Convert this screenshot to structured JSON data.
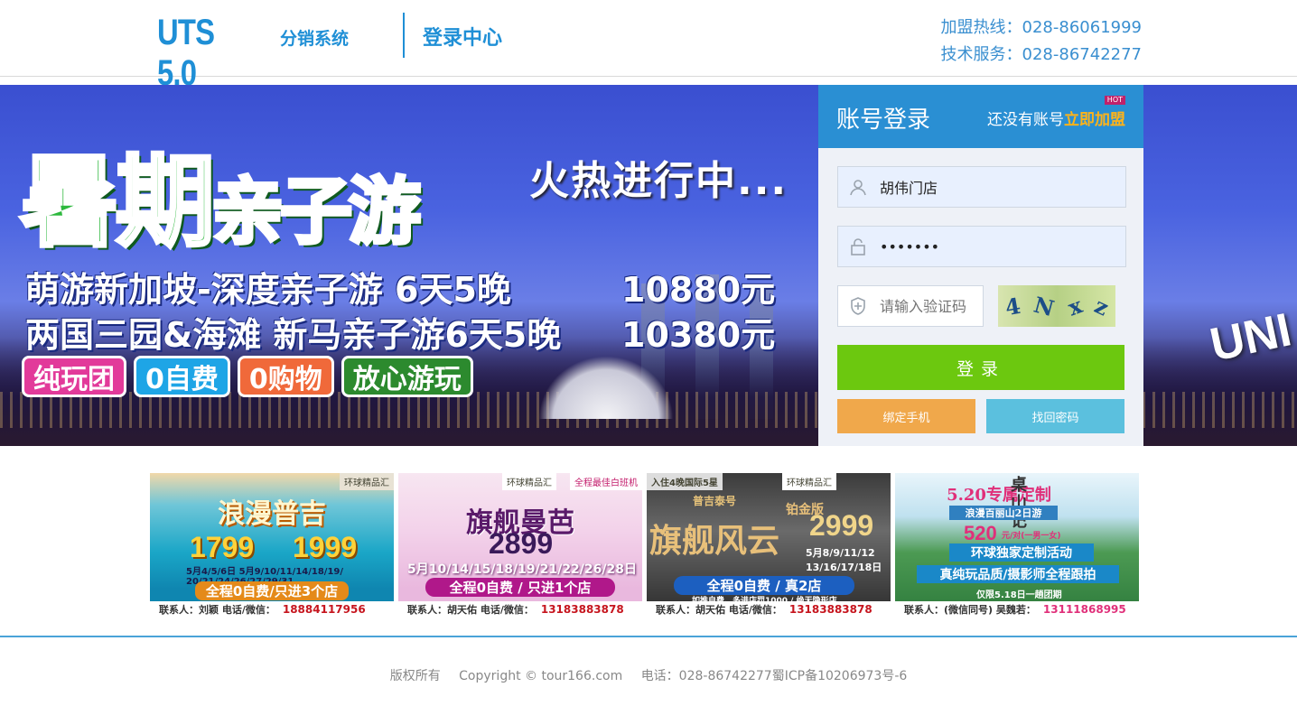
{
  "header": {
    "logo_main": "UTS 5.0",
    "logo_sub": "分销系统",
    "title": "登录中心",
    "hotline_join": "加盟热线：028-86061999",
    "hotline_tech": "技术服务：028-86742277"
  },
  "banner": {
    "headline": "暑期",
    "headline_small": "亲子游",
    "slogan": "火热进行中...",
    "lines": [
      {
        "text": "萌游新加坡-深度亲子游 6天5晚",
        "price": "10880元"
      },
      {
        "text": "两国三园&海滩 新马亲子游6天5晚",
        "price": "10380元"
      }
    ],
    "badges": [
      "纯玩团",
      "0自费",
      "0购物",
      "放心游玩"
    ],
    "badge_colors": [
      "#e23a9a",
      "#1ea5e6",
      "#f0693a",
      "#2c8a2e"
    ],
    "uni_text": "UNI"
  },
  "login": {
    "title": "账号登录",
    "join_prefix": "还没有账号",
    "join_link": "立即加盟",
    "hot": "HOT",
    "username_value": "胡伟门店",
    "password_value": "•••••••",
    "captcha_placeholder": "请输入验证码",
    "captcha_chars": [
      "4",
      "N",
      "x",
      "z"
    ],
    "submit": "登录",
    "bind_phone": "绑定手机",
    "recover": "找回密码",
    "icons": {
      "user": "user-icon",
      "lock": "lock-icon",
      "shield": "shield-icon"
    }
  },
  "promos": [
    {
      "tag": "环球精品汇",
      "title": "浪漫普吉",
      "price_a": "1799",
      "price_b": "1999",
      "dates": "5月4/5/6日 5月9/10/11/14/18/19/ 20/21/24/26/27/29/31",
      "strip": "全程0自费/只进3个店",
      "contact_label": "联系人：刘颖  电话/微信：",
      "contact_number": "18884117956"
    },
    {
      "tag": "环球精品汇",
      "tag2": "全程最佳白班机",
      "title": "旗舰曼芭",
      "price_a": "2899",
      "dates": "5月10/14/15/18/19/21/22/26/28日",
      "strip": "全程0自费 / 只进1个店",
      "contact_label": "联系人：胡天佑  电话/微信：",
      "contact_number": "13183883878"
    },
    {
      "tag": "环球精品汇",
      "tag2": "入住4晚国际5星",
      "title": "旗舰风云",
      "sub": "普吉泰号",
      "label": "铂金版",
      "price_a": "2999",
      "dates": "5月8/9/11/12 13/16/17/18日",
      "strip": "全程0自费 / 真2店",
      "note": "如推自费、多进店罚1000 / 绝无隐形店",
      "contact_label": "联系人：胡天佑  电话/微信：",
      "contact_number": "13183883878"
    },
    {
      "title": "5.20专属定制",
      "side": "桌山记",
      "sub": "浪漫百丽山2日游",
      "price_a": "520",
      "price_suffix": "元/对(一男一女)",
      "strip": "环球独家定制活动",
      "strip2": "真纯玩品质/摄影师全程跟拍",
      "note": "仅限5.18日一趟团期",
      "contact_label": "联系人：(微信同号)  吴魏若：",
      "contact_number": "13111868995"
    }
  ],
  "footer": {
    "rights": "版权所有",
    "copyright": "Copyright © tour166.com",
    "phone": "电话：028-86742277蜀ICP备10206973号-6"
  }
}
